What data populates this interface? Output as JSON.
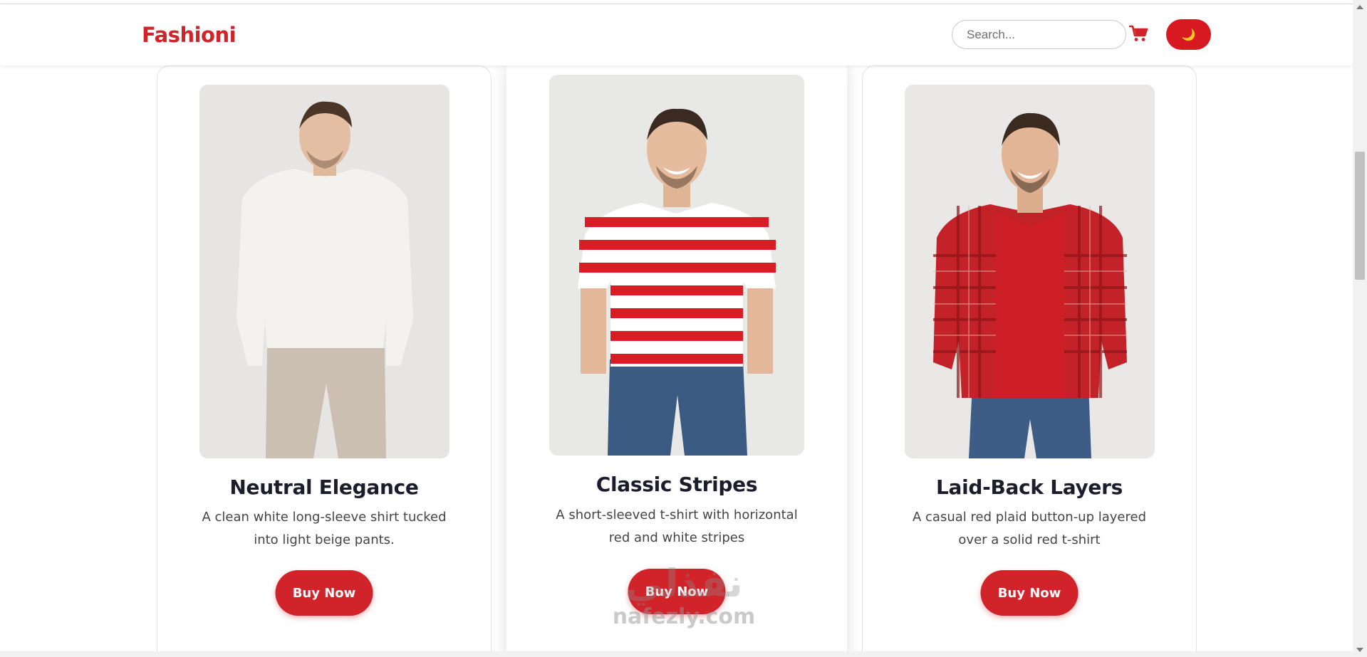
{
  "navbar": {
    "brand": "Fashioni",
    "search_placeholder": "Search...",
    "cart_icon": "cart-icon",
    "theme_toggle_icon": "moon-icon",
    "theme_toggle_glyph": "🌙"
  },
  "products": [
    {
      "title": "Neutral Elegance",
      "description": "A clean white long-sleeve shirt tucked into light beige pants.",
      "button": "Buy Now"
    },
    {
      "title": "Classic Stripes",
      "description": "A short-sleeved t-shirt with horizontal red and white stripes",
      "button": "Buy Now"
    },
    {
      "title": "Laid-Back Layers",
      "description": "A casual red plaid button-up layered over a solid red t-shirt",
      "button": "Buy Now"
    }
  ],
  "watermark": {
    "logo": "نفذلي",
    "text": "nafezly.com"
  },
  "colors": {
    "brand": "#d0232a",
    "button": "#d1232a",
    "title": "#1c1c2b"
  }
}
